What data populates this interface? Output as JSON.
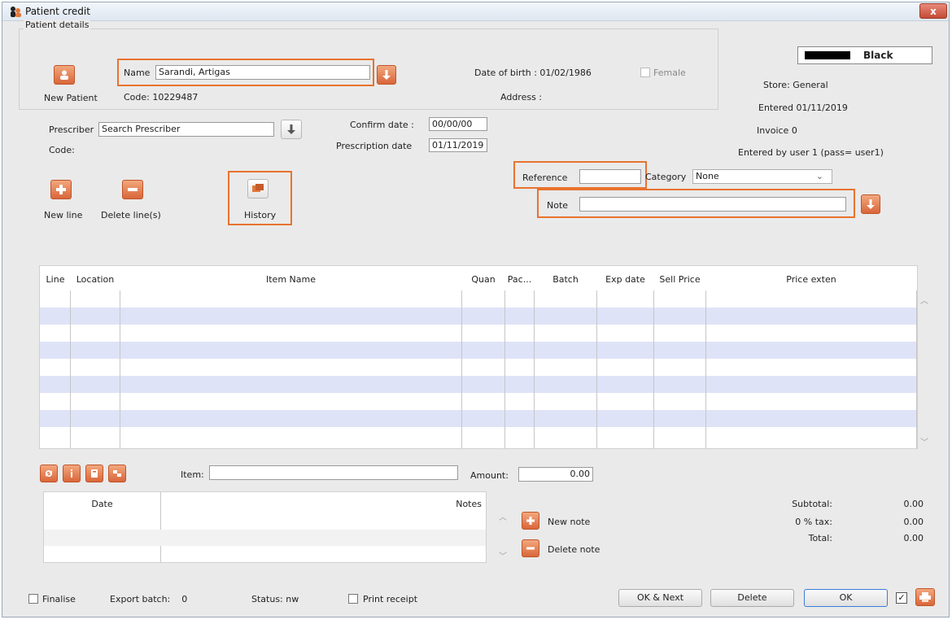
{
  "window": {
    "title": "Patient credit",
    "close_label": "x"
  },
  "patient": {
    "section_label": "Patient details",
    "new_patient_label": "New Patient",
    "name_label": "Name",
    "name_value": "Sarandi, Artigas",
    "code_text": "Code:  10229487",
    "dob_text": "Date of birth : 01/02/1986",
    "female_label": "Female",
    "address_text": "Address :"
  },
  "store_panel": {
    "color_label": "Black",
    "store_text": "Store:  General",
    "entered_text": "Entered  01/11/2019",
    "invoice_text": "Invoice  0",
    "entered_by_text": "Entered by  user 1 (pass= user1)"
  },
  "prescriber": {
    "label": "Prescriber",
    "value": "Search Prescriber",
    "code_label": "Code:"
  },
  "dates": {
    "confirm_label": "Confirm date :",
    "confirm_value": "00/00/00",
    "prescription_label": "Prescription date",
    "prescription_value": "01/11/2019"
  },
  "actions": {
    "new_line": "New line",
    "delete_lines": "Delete line(s)",
    "history": "History"
  },
  "reference": {
    "label": "Reference",
    "value": ""
  },
  "category": {
    "label": "Category",
    "value": "None"
  },
  "note": {
    "label": "Note",
    "value": ""
  },
  "grid": {
    "columns": [
      "Line",
      "Location",
      "Item Name",
      "Quan",
      "Pac...",
      "Batch",
      "Exp date",
      "Sell Price",
      "Price exten"
    ]
  },
  "item_bar": {
    "item_label": "Item:",
    "amount_label": "Amount:",
    "amount_value": "0.00"
  },
  "notes_table": {
    "columns": [
      "Date",
      "Notes"
    ],
    "new_note": "New note",
    "delete_note": "Delete note"
  },
  "totals": {
    "subtotal_label": "Subtotal:",
    "subtotal_value": "0.00",
    "tax_label": "0 % tax:",
    "tax_value": "0.00",
    "total_label": "Total:",
    "total_value": "0.00"
  },
  "footer": {
    "finalise_label": "Finalise",
    "export_batch_text": "Export batch:    0",
    "status_text": "Status: nw",
    "print_receipt_label": "Print receipt",
    "ok_next": "OK & Next",
    "delete": "Delete",
    "ok": "OK"
  }
}
